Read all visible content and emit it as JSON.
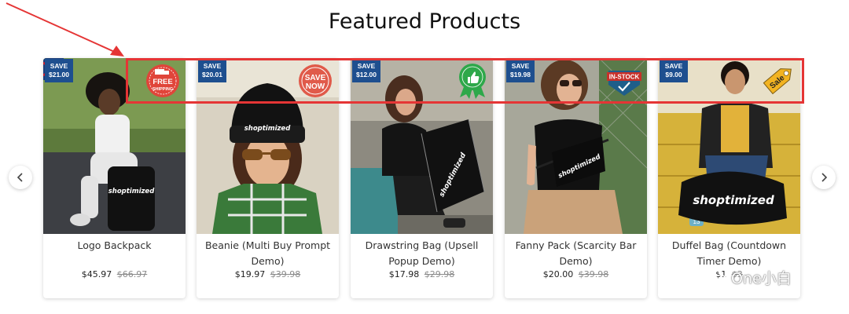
{
  "section": {
    "title": "Featured Products"
  },
  "carousel": {
    "prev_icon": "chevron-left-icon",
    "next_icon": "chevron-right-icon"
  },
  "products": [
    {
      "name": "Logo Backpack",
      "price": "$45.97",
      "old_price": "$66.97",
      "save_label": "SAVE",
      "save_amount": "$21.00",
      "badge_icon": "free-shipping-truck-icon",
      "badge_text_1": "FREE",
      "badge_text_2": "SHIPPING"
    },
    {
      "name": "Beanie (Multi Buy Prompt Demo)",
      "price": "$19.97",
      "old_price": "$39.98",
      "save_label": "SAVE",
      "save_amount": "$20.01",
      "badge_icon": "save-now-seal-icon",
      "badge_text_1": "SAVE",
      "badge_text_2": "NOW"
    },
    {
      "name": "Drawstring Bag (Upsell Popup Demo)",
      "price": "$17.98",
      "old_price": "$29.98",
      "save_label": "SAVE",
      "save_amount": "$12.00",
      "badge_icon": "best-seller-thumbs-up-icon"
    },
    {
      "name": "Fanny Pack (Scarcity Bar Demo)",
      "price": "$20.00",
      "old_price": "$39.98",
      "save_label": "SAVE",
      "save_amount": "$19.98",
      "badge_icon": "in-stock-check-icon",
      "badge_text_1": "IN-STOCK"
    },
    {
      "name": "Duffel Bag (Countdown Timer Demo)",
      "price": "$1",
      "old_price": "$3",
      "save_label": "SAVE",
      "save_amount": "$9.00",
      "badge_icon": "sale-tag-icon",
      "badge_text_1": "Sale"
    }
  ],
  "brand": {
    "print": "shoptimized"
  },
  "watermark": {
    "text": "One小白",
    "icon": "wechat-icon"
  },
  "colors": {
    "save_badge": "#1e4f8f",
    "annotation": "#e53535",
    "free_shipping": "#e0453a",
    "save_now": "#e05a4a",
    "best_seller": "#2ea84a",
    "in_stock": "#1f5e8a",
    "sale_tag": "#f2b321"
  }
}
